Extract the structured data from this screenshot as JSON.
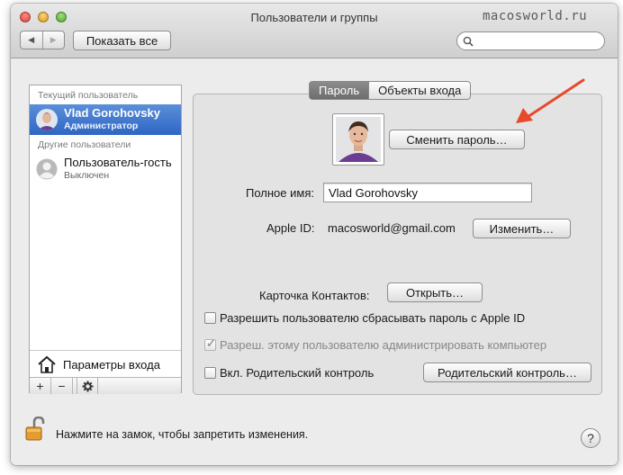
{
  "window": {
    "title": "Пользователи и группы",
    "watermark": "macosworld.ru",
    "show_all_label": "Показать все",
    "search_placeholder": ""
  },
  "sidebar": {
    "current_user_header": "Текущий пользователь",
    "other_users_header": "Другие пользователи",
    "users": [
      {
        "name": "Vlad Gorohovsky",
        "role": "Администратор",
        "selected": true
      },
      {
        "name": "Пользователь-гость",
        "role": "Выключен",
        "selected": false
      }
    ],
    "login_options_label": "Параметры входа",
    "tools": {
      "add": "+",
      "remove": "−",
      "action_icon": "gear-icon"
    }
  },
  "tabs": [
    {
      "label": "Пароль",
      "active": true
    },
    {
      "label": "Объекты входа",
      "active": false
    }
  ],
  "account": {
    "change_password_label": "Сменить пароль…",
    "full_name_label": "Полное имя:",
    "full_name_value": "Vlad Gorohovsky",
    "apple_id_label": "Apple ID:",
    "apple_id_value": "macosworld@gmail.com",
    "apple_id_change_label": "Изменить…",
    "contacts_card_label": "Карточка Контактов:",
    "open_label": "Открыть…"
  },
  "options": [
    {
      "label": "Разрешить пользователю сбрасывать пароль с Apple ID",
      "checked": false,
      "enabled": true
    },
    {
      "label": "Разреш. этому пользователю администрировать компьютер",
      "checked": true,
      "enabled": false
    },
    {
      "label": "Вкл. Родительский контроль",
      "checked": false,
      "enabled": true
    }
  ],
  "parental_controls_button": "Родительский контроль…",
  "footer": {
    "lock_text": "Нажмите на замок, чтобы запретить изменения.",
    "help": "?"
  },
  "colors": {
    "selection": "#3a72cf",
    "annotation_arrow": "#e8492c"
  }
}
